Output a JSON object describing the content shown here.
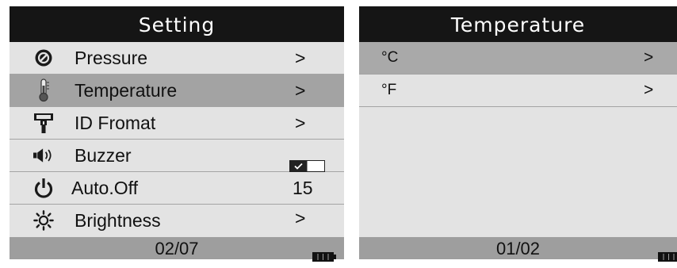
{
  "settings": {
    "title": "Setting",
    "items": [
      {
        "label": "Pressure",
        "value": ">",
        "icon": "gauge-icon"
      },
      {
        "label": "Temperature",
        "value": ">",
        "icon": "thermometer-icon",
        "selected": true
      },
      {
        "label": "ID Fromat",
        "value": ">",
        "icon": "valve-icon"
      },
      {
        "label": "Buzzer",
        "value": "",
        "icon": "speaker-icon",
        "toggle_on": true
      },
      {
        "label": "Auto.Off",
        "value": "15",
        "icon": "power-icon"
      },
      {
        "label": "Brightness",
        "value": ">",
        "icon": "sun-icon"
      }
    ],
    "page": "02/07"
  },
  "temperature": {
    "title": "Temperature",
    "items": [
      {
        "label": "°C",
        "value": ">",
        "selected": true
      },
      {
        "label": "°F",
        "value": ">"
      }
    ],
    "page": "01/02"
  },
  "colors": {
    "header": "#151515",
    "panel": "#e3e3e3",
    "selected": "#a3a3a3",
    "footer": "#9e9e9e"
  }
}
